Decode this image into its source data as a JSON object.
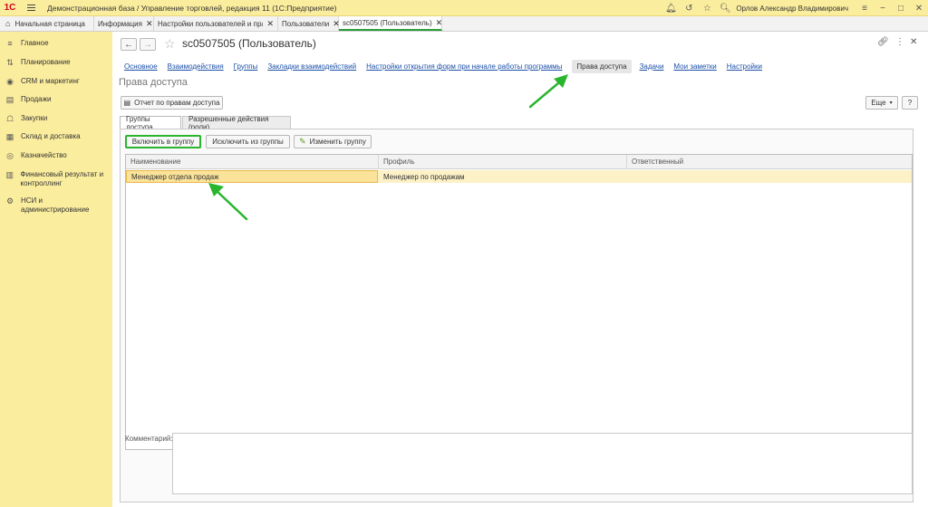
{
  "titlebar": {
    "logo": "1С",
    "title": "Демонстрационная база / Управление торговлей, редакция 11  (1С:Предприятие)",
    "user": "Орлов Александр Владимирович"
  },
  "tabs": {
    "home": "Начальная страница",
    "items": [
      {
        "label": "Информация"
      },
      {
        "label": "Настройки пользователей и прав"
      },
      {
        "label": "Пользователи"
      },
      {
        "label": "sc0507505 (Пользователь)"
      }
    ]
  },
  "sidebar": {
    "items": [
      {
        "label": "Главное",
        "icon": "menu-lines-icon"
      },
      {
        "label": "Планирование",
        "icon": "planning-icon"
      },
      {
        "label": "CRM и маркетинг",
        "icon": "crm-icon"
      },
      {
        "label": "Продажи",
        "icon": "sales-icon"
      },
      {
        "label": "Закупки",
        "icon": "cart-icon"
      },
      {
        "label": "Склад и доставка",
        "icon": "warehouse-icon"
      },
      {
        "label": "Казначейство",
        "icon": "treasury-icon"
      },
      {
        "label": "Финансовый результат и контроллинг",
        "icon": "finance-icon"
      },
      {
        "label": "НСИ и администрирование",
        "icon": "gear-icon"
      }
    ]
  },
  "form": {
    "title": "sc0507505 (Пользователь)",
    "links": [
      "Основное",
      "Взаимодействия",
      "Группы",
      "Закладки взаимодействий",
      "Настройки открытия форм при начале работы программы",
      "Права доступа",
      "Задачи",
      "Мои заметки",
      "Настройки"
    ],
    "active_link": "Права доступа",
    "section_title": "Права доступа",
    "report_button": "Отчет по правам доступа",
    "more_button": "Еще",
    "help_button": "?",
    "subtabs": [
      "Группы доступа",
      "Разрешенные действия (роли)"
    ],
    "toolbar": {
      "include": "Включить в группу",
      "exclude": "Исключить из группы",
      "edit": "Изменить группу"
    },
    "table": {
      "headers": [
        "Наименование",
        "Профиль",
        "Ответственный"
      ],
      "rows": [
        {
          "name": "Менеджер отдела продаж",
          "profile": "Менеджер по продажам",
          "responsible": ""
        }
      ]
    },
    "comment_label": "Комментарий:"
  },
  "colors": {
    "accent_yellow": "#fbed9e",
    "link_blue": "#1b4fa8",
    "highlight_green": "#2ab52e",
    "selected_row": "#fdf1c7"
  }
}
